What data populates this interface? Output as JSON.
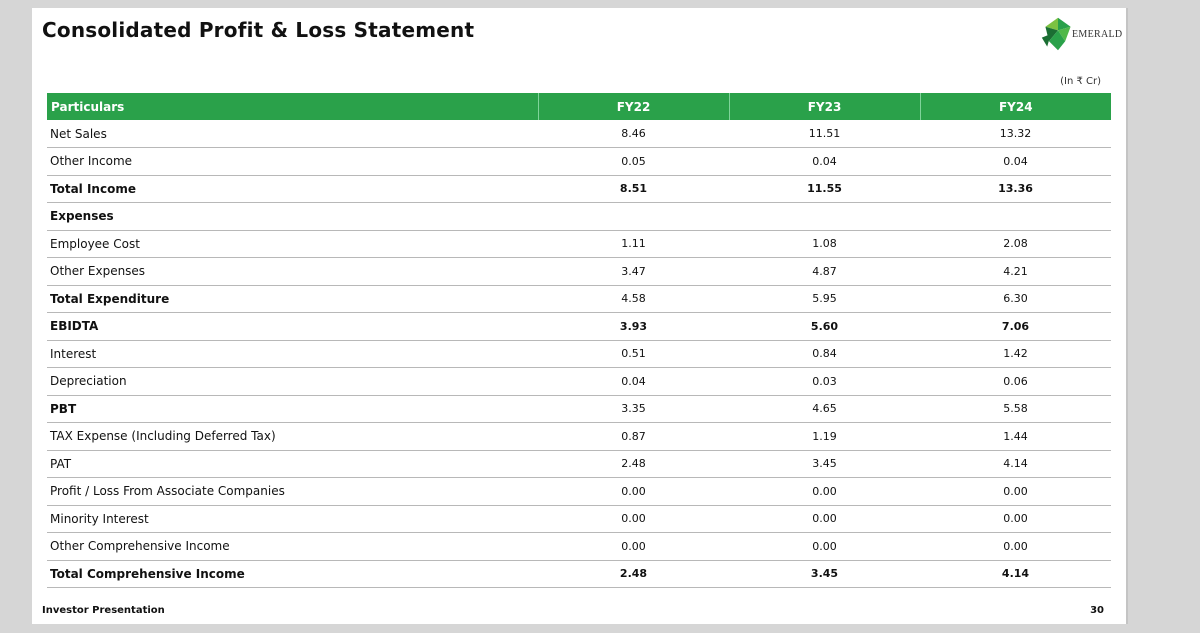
{
  "title": "Consolidated Profit & Loss Statement",
  "logo": {
    "text": "EMERALD",
    "icon": "emerald-logo-icon",
    "colors": [
      "#2aa14a",
      "#7cc242",
      "#1b6e33"
    ]
  },
  "units": "(In ₹ Cr)",
  "table": {
    "headers": [
      "Particulars",
      "FY22",
      "FY23",
      "FY24"
    ],
    "header_color": "#2aa14a",
    "rows": [
      {
        "label": "Net Sales",
        "bold": false,
        "values": [
          "8.46",
          "11.51",
          "13.32"
        ]
      },
      {
        "label": "Other Income",
        "bold": false,
        "values": [
          "0.05",
          "0.04",
          "0.04"
        ]
      },
      {
        "label": "Total Income",
        "bold": true,
        "values": [
          "8.51",
          "11.55",
          "13.36"
        ]
      },
      {
        "label": "Expenses",
        "bold": true,
        "values": [
          "",
          "",
          ""
        ]
      },
      {
        "label": "Employee Cost",
        "bold": false,
        "values": [
          "1.11",
          "1.08",
          "2.08"
        ]
      },
      {
        "label": "Other Expenses",
        "bold": false,
        "values": [
          "3.47",
          "4.87",
          "4.21"
        ]
      },
      {
        "label": "Total Expenditure",
        "bold": true,
        "values": [
          "4.58",
          "5.95",
          "6.30"
        ],
        "values_bold": false
      },
      {
        "label": "EBIDTA",
        "bold": true,
        "values": [
          "3.93",
          "5.60",
          "7.06"
        ]
      },
      {
        "label": "Interest",
        "bold": false,
        "values": [
          "0.51",
          "0.84",
          "1.42"
        ]
      },
      {
        "label": "Depreciation",
        "bold": false,
        "values": [
          "0.04",
          "0.03",
          "0.06"
        ]
      },
      {
        "label": "PBT",
        "bold": true,
        "values": [
          "3.35",
          "4.65",
          "5.58"
        ],
        "values_bold": false
      },
      {
        "label": "TAX Expense (Including Deferred Tax)",
        "bold": false,
        "values": [
          "0.87",
          "1.19",
          "1.44"
        ]
      },
      {
        "label": "PAT",
        "bold": false,
        "values": [
          "2.48",
          "3.45",
          "4.14"
        ]
      },
      {
        "label": "Profit / Loss From Associate Companies",
        "bold": false,
        "values": [
          "0.00",
          "0.00",
          "0.00"
        ]
      },
      {
        "label": "Minority Interest",
        "bold": false,
        "values": [
          "0.00",
          "0.00",
          "0.00"
        ]
      },
      {
        "label": "Other Comprehensive Income",
        "bold": false,
        "values": [
          "0.00",
          "0.00",
          "0.00"
        ]
      },
      {
        "label": "Total Comprehensive Income",
        "bold": true,
        "values": [
          "2.48",
          "3.45",
          "4.14"
        ]
      }
    ]
  },
  "footer": {
    "left": "Investor Presentation",
    "page_number": "30"
  }
}
